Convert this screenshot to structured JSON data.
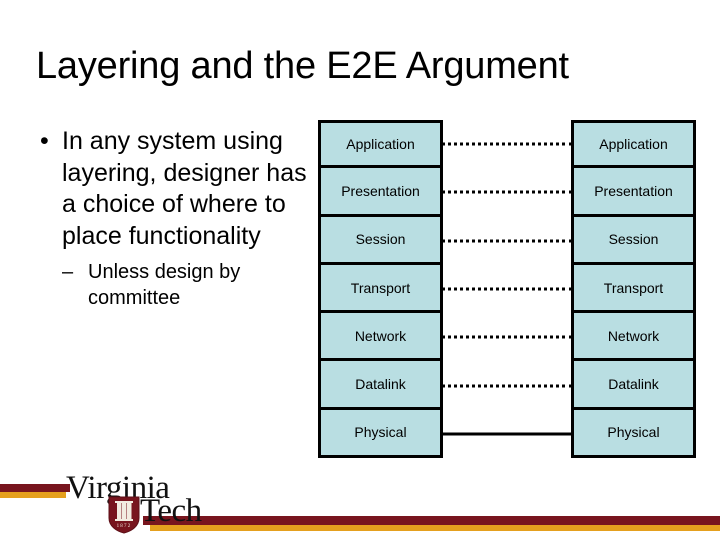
{
  "slide": {
    "title": "Layering and the E2E Argument",
    "bullets": [
      {
        "marker": "•",
        "text": "In any system using layering, designer has a choice of where to place functionality",
        "level": 1
      },
      {
        "marker": "–",
        "text": "Unless design by committee",
        "level": 2
      }
    ]
  },
  "diagram": {
    "name": "osi-layer-stacks",
    "left_stack_label": "Left protocol stack",
    "right_stack_label": "Right protocol stack",
    "box_fill_color": "#b9dee2",
    "box_border_color": "#000000",
    "layers": [
      {
        "label": "Application",
        "connector": "dotted"
      },
      {
        "label": "Presentation",
        "connector": "dotted"
      },
      {
        "label": "Session",
        "connector": "dotted"
      },
      {
        "label": "Transport",
        "connector": "dotted"
      },
      {
        "label": "Network",
        "connector": "dotted"
      },
      {
        "label": "Datalink",
        "connector": "dotted"
      },
      {
        "label": "Physical",
        "connector": "solid"
      }
    ]
  },
  "footer": {
    "logo": {
      "word_one": "Virginia",
      "word_two": "Tech",
      "shield_year": "1872",
      "maroon": "#78151e",
      "orange": "#e5a01e"
    }
  }
}
